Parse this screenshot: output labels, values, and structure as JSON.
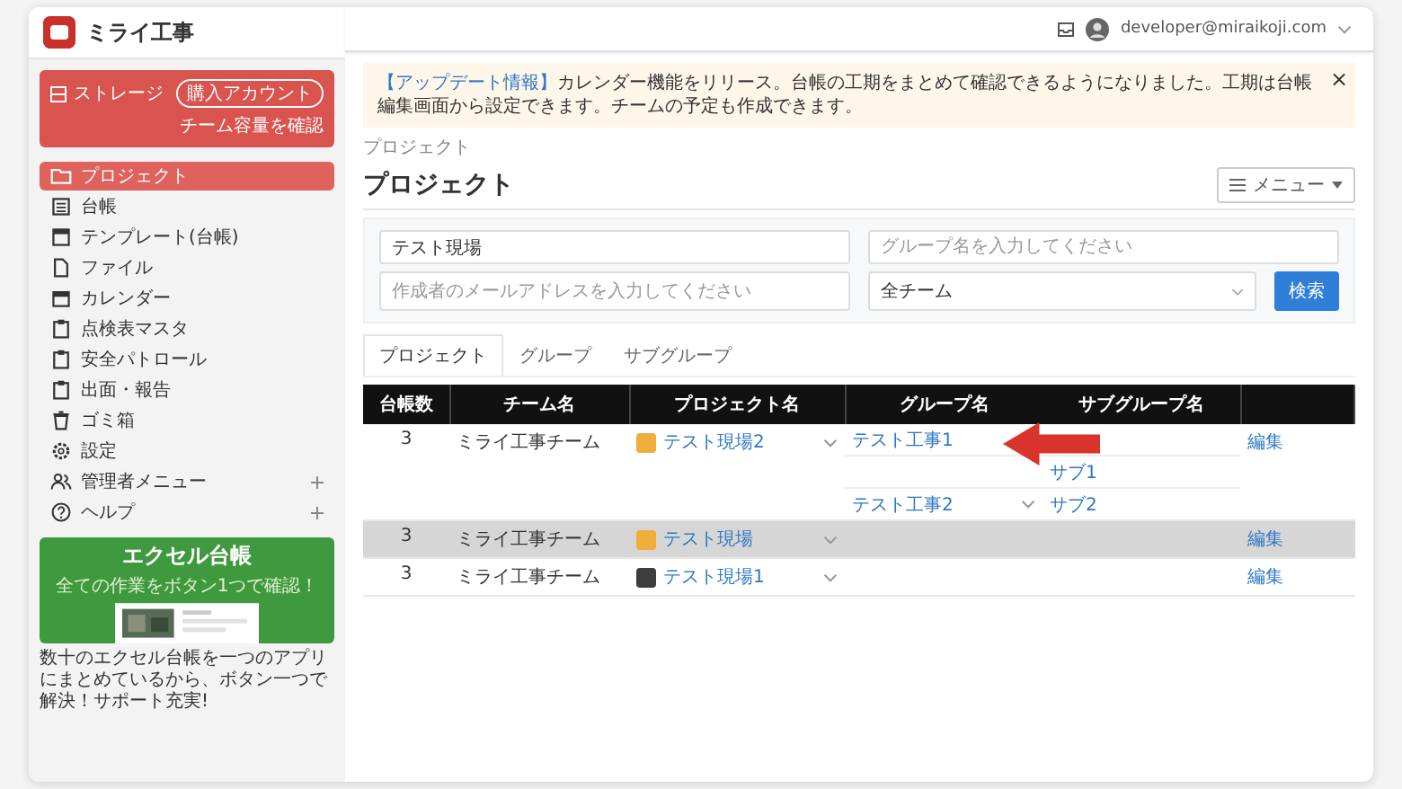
{
  "sidebar": {
    "logo": "ミライ工事",
    "storage": {
      "label": "ストレージ",
      "button": "購入アカウント",
      "link": "チーム容量を確認"
    },
    "items": [
      {
        "label": "プロジェクト",
        "selected": true,
        "expandable": false
      },
      {
        "label": "台帳",
        "selected": false,
        "expandable": false
      },
      {
        "label": "テンプレート(台帳)",
        "selected": false,
        "expandable": false
      },
      {
        "label": "ファイル",
        "selected": false,
        "expandable": false
      },
      {
        "label": "カレンダー",
        "selected": false,
        "expandable": false
      },
      {
        "label": "点検表マスタ",
        "selected": false,
        "expandable": false
      },
      {
        "label": "安全パトロール",
        "selected": false,
        "expandable": false
      },
      {
        "label": "出面・報告",
        "selected": false,
        "expandable": false
      },
      {
        "label": "ゴミ箱",
        "selected": false,
        "expandable": false
      },
      {
        "label": "設定",
        "selected": false,
        "expandable": false
      },
      {
        "label": "管理者メニュー",
        "selected": false,
        "expandable": true
      },
      {
        "label": "ヘルプ",
        "selected": false,
        "expandable": true
      }
    ],
    "promo": {
      "title": "エクセル台帳",
      "subtitle": "全ての作業をボタン1つで確認！",
      "text": "数十のエクセル台帳を一つのアプリにまとめているから、ボタン一つで解決！サポート充実!"
    }
  },
  "header": {
    "email": "developer@miraikoji.com"
  },
  "notice": {
    "tag": "【アップデート情報】",
    "text": "カレンダー機能をリリース。台帳の工期をまとめて確認できるようになりました。工期は台帳編集画面から設定できます。チームの予定も作成できます。",
    "close": "×"
  },
  "breadcrumb": "プロジェクト",
  "title": "プロジェクト",
  "menu_button": "メニュー",
  "filters": {
    "project": {
      "value": "テスト現場"
    },
    "group": {
      "placeholder": "グループ名を入力してください"
    },
    "creator": {
      "placeholder": "作成者のメールアドレスを入力してください"
    },
    "team": {
      "value": "全チーム"
    },
    "search_button": "検索"
  },
  "tabs": [
    {
      "label": "プロジェクト",
      "selected": true
    },
    {
      "label": "グループ",
      "selected": false
    },
    {
      "label": "サブグループ",
      "selected": false
    }
  ],
  "table": {
    "columns": [
      "台帳数",
      "チーム名",
      "プロジェクト名",
      "グループ名",
      "サブグループ名"
    ],
    "rows": [
      {
        "count": "3",
        "team": "ミライ工事チーム",
        "project": "テスト現場2",
        "color": "#f0ad3c",
        "selected": false,
        "edit": "編集",
        "groups": [
          {
            "group": "テスト工事1"
          },
          {
            "subgroup": "サブ1"
          },
          {
            "group": "テスト工事2",
            "subgroup": "サブ2",
            "chevron": true
          }
        ]
      },
      {
        "count": "3",
        "team": "ミライ工事チーム",
        "project": "テスト現場",
        "color": "#f0ad3c",
        "selected": true,
        "edit": "編集",
        "groups": []
      },
      {
        "count": "3",
        "team": "ミライ工事チーム",
        "project": "テスト現場1",
        "color": "#3d3d3d",
        "selected": false,
        "edit": "編集",
        "groups": []
      }
    ]
  },
  "annotation": {
    "kind": "arrow"
  }
}
